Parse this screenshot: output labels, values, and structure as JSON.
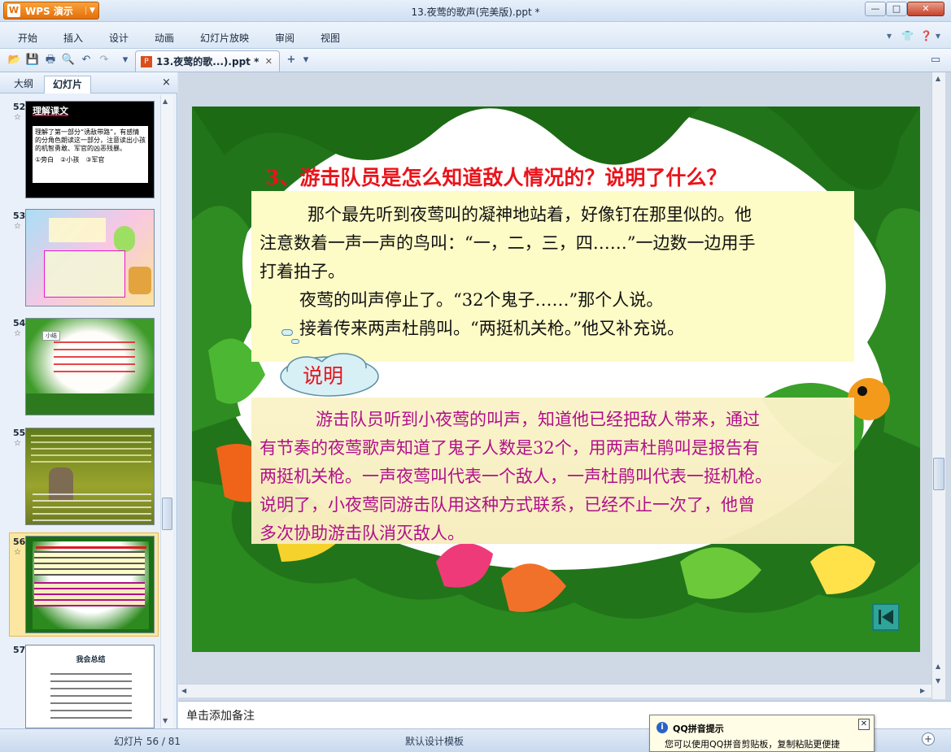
{
  "window": {
    "app_button": "WPS 演示",
    "title": "13.夜莺的歌声(完美版).ppt *",
    "min": "—",
    "max": "□",
    "close": "✕"
  },
  "menu": {
    "items": [
      "开始",
      "插入",
      "设计",
      "动画",
      "幻灯片放映",
      "审阅",
      "视图"
    ]
  },
  "toolbar": {
    "doc_tab": "13.夜莺的歌...).ppt *",
    "new_tab": "+"
  },
  "left_panel": {
    "tabs": [
      "大纲",
      "幻灯片"
    ],
    "close": "×",
    "slides": [
      {
        "num": "52",
        "title": "理解课文",
        "text": "理解了第一部分“诱敌带路”，有感情的分角色朗读这一部分，注意读出小孩的机智勇敢、军官的凶恶残暴。",
        "options": "①旁白　②小孩　③军官"
      },
      {
        "num": "53"
      },
      {
        "num": "54",
        "label": "小结"
      },
      {
        "num": "55"
      },
      {
        "num": "56"
      },
      {
        "num": "57",
        "title": "我会总结"
      }
    ]
  },
  "slide": {
    "title": "3、游击队员是怎么知道敌人情况的？说明了什么？",
    "passage": [
      "那个最先听到夜莺叫的凝神地站着，好像钉在那里似的。他",
      "注意数着一声一声的鸟叫：“一，二，三，四……”一边数一边用手",
      "打着拍子。",
      "夜莺的叫声停止了。“32个鬼子……”那个人说。",
      "接着传来两声杜鹃叫。“两挺机关枪。”他又补充说。"
    ],
    "explain_label": "说明",
    "explanation": [
      "游击队员听到小夜莺的叫声，知道他已经把敌人带来，通过",
      "有节奏的夜莺歌声知道了鬼子人数是32个，用两声杜鹃叫是报告有",
      "两挺机关枪。一声夜莺叫代表一个敌人，一声杜鹃叫代表一挺机枪。",
      "说明了，小夜莺同游击队用这种方式联系，已经不止一次了，他曾",
      "多次协助游击队消灭敌人。"
    ]
  },
  "notes": {
    "placeholder": "单击添加备注"
  },
  "status": {
    "slide_counter": "幻灯片 56 / 81",
    "template": "默认设计模板"
  },
  "qq_tip": {
    "title": "QQ拼音提示",
    "message": "您可以使用QQ拼音剪贴板，复制粘贴更便捷"
  },
  "colors": {
    "title_red": "#e8141b",
    "explain_magenta": "#b0108a",
    "selection": "#fbe7a1"
  }
}
